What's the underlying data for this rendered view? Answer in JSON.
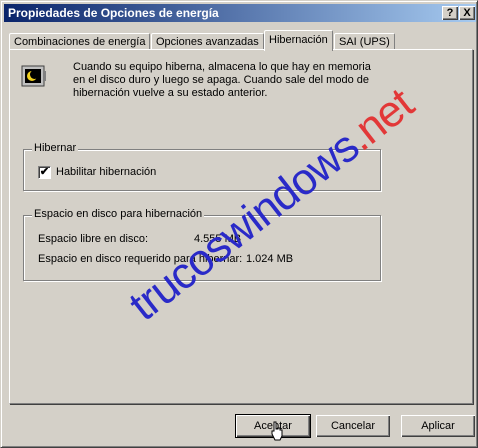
{
  "window": {
    "title": "Propiedades de Opciones de energía",
    "help_button": "?",
    "close_button": "X"
  },
  "tabs": [
    {
      "label": "Combinaciones de energía",
      "active": false
    },
    {
      "label": "Opciones avanzadas",
      "active": false
    },
    {
      "label": "Hibernación",
      "active": true
    },
    {
      "label": "SAI (UPS)",
      "active": false
    }
  ],
  "hibernation_tab": {
    "icon": "hibernate-moon-icon",
    "description": "Cuando su equipo hiberna, almacena lo que hay en memoria en el disco duro y luego se apaga. Cuando sale del modo de hibernación vuelve a su estado anterior.",
    "hibernate_group": {
      "legend": "Hibernar",
      "enable_checkbox": {
        "label": "Habilitar hibernación",
        "checked": true,
        "mark": "✔"
      }
    },
    "disk_group": {
      "legend": "Espacio en disco para hibernación",
      "free_label": "Espacio libre en disco:",
      "free_value": "4.555 MB",
      "required_label": "Espacio en disco requerido para hibernar:",
      "required_value": "1.024 MB"
    }
  },
  "watermark": {
    "main": "trucoswindows",
    "accent": ".net"
  },
  "buttons": {
    "ok": "Aceptar",
    "cancel": "Cancelar",
    "apply": "Aplicar"
  },
  "colors": {
    "title_start": "#0a246a",
    "title_end": "#a6caf0",
    "face": "#d4d0c8",
    "watermark_blue": "#2a2ac8",
    "watermark_red": "#e23838"
  }
}
